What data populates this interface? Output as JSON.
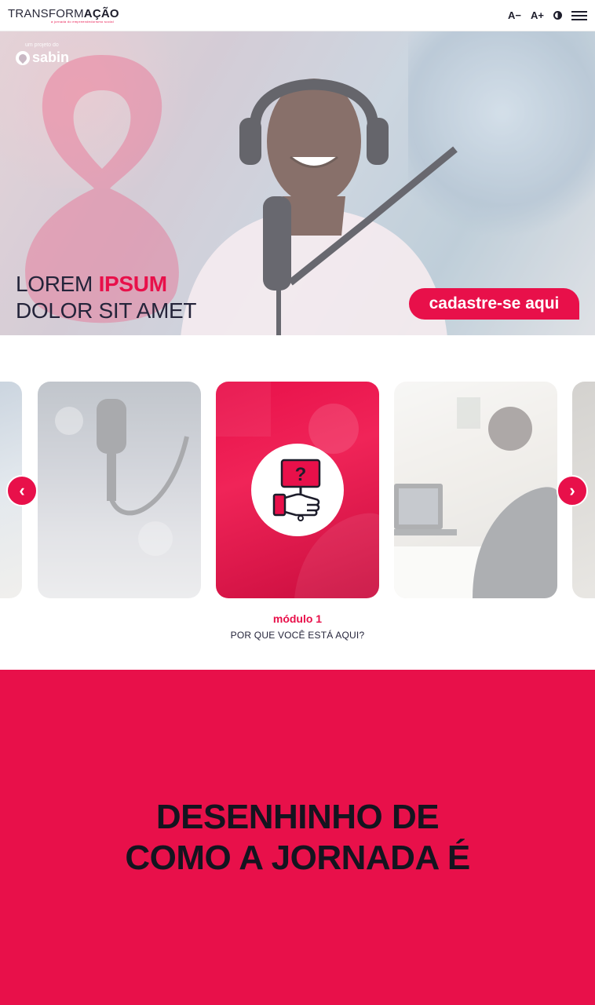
{
  "header": {
    "logo_light": "TRANSFORM",
    "logo_bold": "AÇÃO",
    "logo_tagline": "a jornada do empreendedorismo social",
    "font_decrease": "A−",
    "font_increase": "A+",
    "icons": {
      "contrast": "contrast-icon",
      "menu": "hamburger-menu-icon"
    }
  },
  "hero": {
    "partner_small": "um projeto do",
    "partner_name": "sabin",
    "title_line1_light": "LOREM ",
    "title_line1_accent": "IPSUM",
    "title_line2": "DOLOR SIT AMET",
    "cta_label": "cadastre-se aqui"
  },
  "carousel": {
    "prev_icon": "chevron-left-icon",
    "next_icon": "chevron-right-icon",
    "active_icon": "question-sign-hand-icon",
    "module_label": "módulo 1",
    "module_title": "POR QUE VOCÊ ESTÁ AQUI?"
  },
  "journey": {
    "title_line1": "DESENHINHO DE",
    "title_line2": "COMO A JORNADA É"
  },
  "colors": {
    "accent": "#e8104a",
    "dark": "#1d1d2b"
  }
}
